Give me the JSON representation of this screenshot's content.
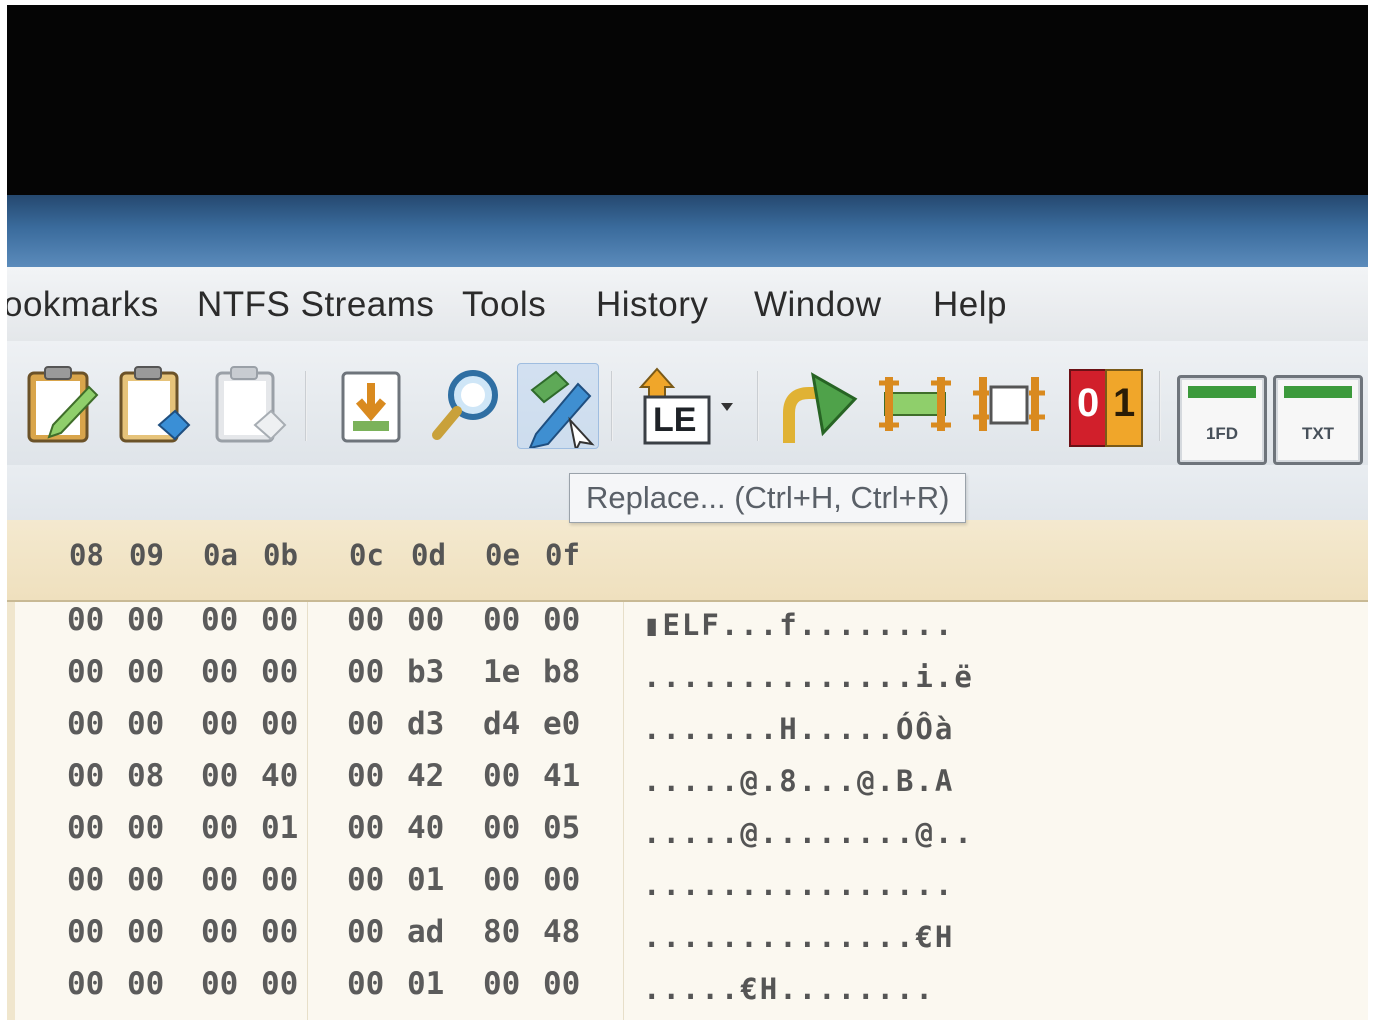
{
  "menu": {
    "items": [
      {
        "label": "ookmarks"
      },
      {
        "label": "NTFS Streams"
      },
      {
        "label": "Tools"
      },
      {
        "label": "History"
      },
      {
        "label": "Window"
      },
      {
        "label": "Help"
      }
    ]
  },
  "toolbar": {
    "bin_toggle": {
      "zero": "0",
      "one": "1"
    },
    "byte_order_label": "LE",
    "file_tabs": [
      {
        "label": "1FD"
      },
      {
        "label": "TXT"
      }
    ],
    "tooltip": "Replace...  (Ctrl+H, Ctrl+R)"
  },
  "columns": {
    "offsets": [
      "08",
      "09",
      "0a",
      "0b",
      "0c",
      "0d",
      "0e",
      "0f"
    ]
  },
  "rows": [
    {
      "bytes": [
        "00",
        "00",
        "00",
        "00",
        "00",
        "00",
        "00",
        "00"
      ],
      "text": "▮ELF...f........"
    },
    {
      "bytes": [
        "00",
        "00",
        "00",
        "00",
        "00",
        "b3",
        "1e",
        "b8"
      ],
      "text": "..............i.ë"
    },
    {
      "bytes": [
        "00",
        "00",
        "00",
        "00",
        "00",
        "d3",
        "d4",
        "e0"
      ],
      "text": ".......H.....ÓÔà"
    },
    {
      "bytes": [
        "00",
        "08",
        "00",
        "40",
        "00",
        "42",
        "00",
        "41"
      ],
      "text": ".....@.8...@.B.A"
    },
    {
      "bytes": [
        "00",
        "00",
        "00",
        "01",
        "00",
        "40",
        "00",
        "05"
      ],
      "text": ".....@........@.."
    },
    {
      "bytes": [
        "00",
        "00",
        "00",
        "00",
        "00",
        "01",
        "00",
        "00"
      ],
      "text": "................"
    },
    {
      "bytes": [
        "00",
        "00",
        "00",
        "00",
        "00",
        "ad",
        "80",
        "48"
      ],
      "text": "..............­€H"
    },
    {
      "bytes": [
        "00",
        "00",
        "00",
        "00",
        "00",
        "01",
        "00",
        "00"
      ],
      "text": ".....­€H........"
    }
  ],
  "colors": {
    "title_gradient_top": "#25486f",
    "column_header_bg": "#f4e9cf",
    "bit_zero_bg": "#d11f2b",
    "bit_one_bg": "#f0a62a"
  }
}
